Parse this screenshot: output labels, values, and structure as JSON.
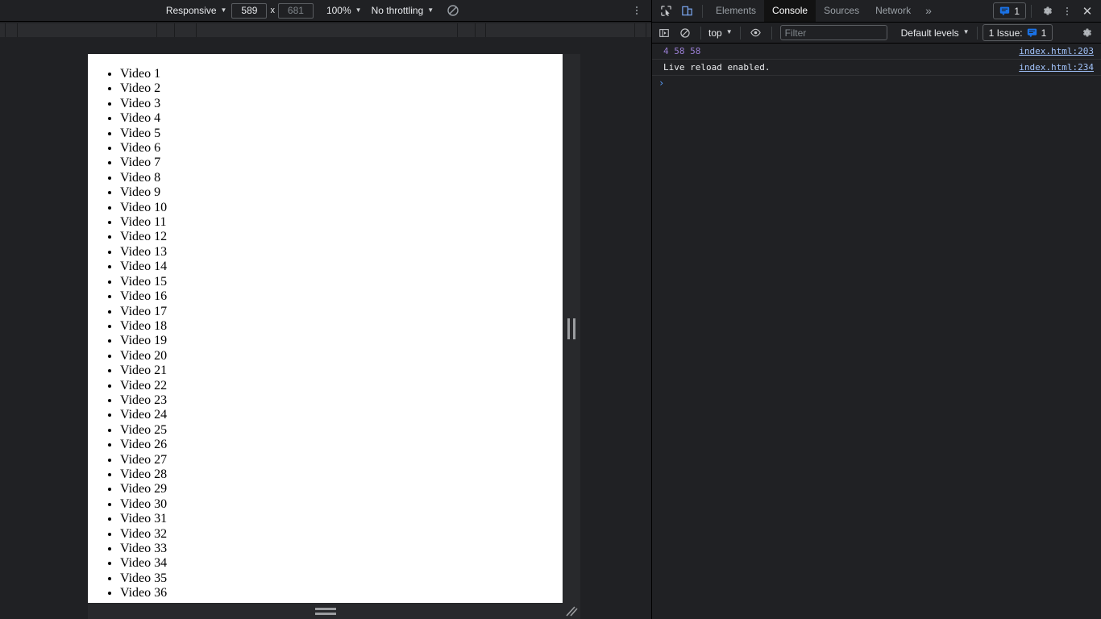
{
  "device_toolbar": {
    "device_select": "Responsive",
    "width_value": "589",
    "height_value": "681",
    "x_separator": "x",
    "zoom": "100%",
    "throttling": "No throttling",
    "rotate_icon": "no-throttling-blocked-icon",
    "menu_icon": "more-options-icon"
  },
  "page": {
    "items": [
      "Video 1",
      "Video 2",
      "Video 3",
      "Video 4",
      "Video 5",
      "Video 6",
      "Video 7",
      "Video 8",
      "Video 9",
      "Video 10",
      "Video 11",
      "Video 12",
      "Video 13",
      "Video 14",
      "Video 15",
      "Video 16",
      "Video 17",
      "Video 18",
      "Video 19",
      "Video 20",
      "Video 21",
      "Video 22",
      "Video 23",
      "Video 24",
      "Video 25",
      "Video 26",
      "Video 27",
      "Video 28",
      "Video 29",
      "Video 30",
      "Video 31",
      "Video 32",
      "Video 33",
      "Video 34",
      "Video 35",
      "Video 36"
    ]
  },
  "devtools": {
    "inspect_icon": "inspect-element-icon",
    "device_toggle_icon": "device-toolbar-icon",
    "tabs": [
      {
        "label": "Elements",
        "selected": false
      },
      {
        "label": "Console",
        "selected": true
      },
      {
        "label": "Sources",
        "selected": false
      },
      {
        "label": "Network",
        "selected": false
      }
    ],
    "more_tabs": "»",
    "issues_badge_count": "1",
    "settings_icon": "gear-icon",
    "main_menu_icon": "more-options-icon",
    "close_icon": "close-icon"
  },
  "console_toolbar": {
    "sidebar_icon": "console-sidebar-icon",
    "clear_icon": "clear-console-icon",
    "context": "top",
    "eye_icon": "live-expression-icon",
    "filter_placeholder": "Filter",
    "filter_value": "",
    "levels": "Default levels",
    "issues_label": "1 Issue:",
    "issues_count": "1",
    "settings_icon": "console-settings-gear-icon"
  },
  "console_messages": [
    {
      "text": "4 58 58",
      "style": "numeric",
      "source": "index.html:203"
    },
    {
      "text": "Live reload enabled.",
      "style": "plain",
      "source": "index.html:234"
    }
  ],
  "prompt": {
    "chevron": "›"
  },
  "resizers": {
    "right_handle": "viewport-width-resize-handle",
    "bottom_handle": "viewport-height-resize-handle",
    "corner_handle": "viewport-corner-resize-handle"
  },
  "colors": {
    "background": "#202124",
    "toolbar": "#202124",
    "viewport": "#ffffff",
    "accent_blue": "#5a9cf8",
    "link_blue": "#a1c2fa",
    "number_purple": "#9a7fd4",
    "resizer": "#28292c"
  }
}
